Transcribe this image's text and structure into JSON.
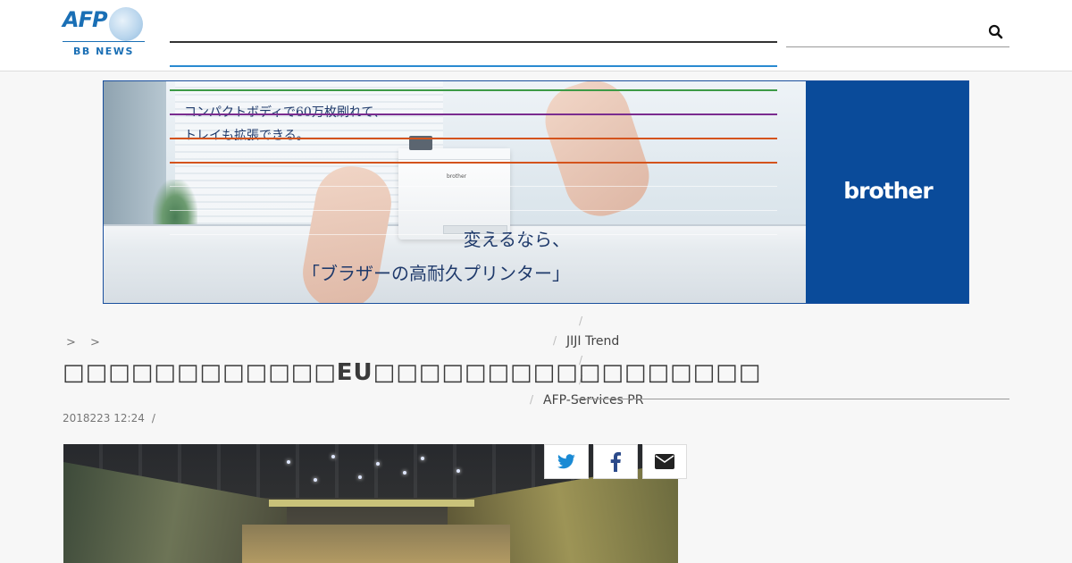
{
  "header": {
    "logo_text": "AFP",
    "logo_subtitle": "BB NEWS",
    "search_icon": "search-icon"
  },
  "ad": {
    "copy_lines": "コンパクトボディで60万枚刷れて、\nトレイも拡張できる。",
    "printer_brand": "brother",
    "headline": "変えるなら、\n「ブラザーの高耐久プリンター」",
    "brand": "brother",
    "brand_color": "#0a4b9a"
  },
  "nav": {
    "separators": [
      "/",
      "/",
      "/",
      "/",
      "/"
    ],
    "items": [
      "JIJI Trend",
      "AFP-Services PR"
    ]
  },
  "breadcrumb": "> >",
  "article": {
    "title": "□□□□□□□□□□□□EU□□□□□□□□□□□□□□□□□",
    "date": "2018223 12:24",
    "meta_sep": "/"
  },
  "share": {
    "icons": [
      "twitter-icon",
      "facebook-icon",
      "email-icon"
    ]
  },
  "colors": {
    "nav_lines": [
      "#333333",
      "#2a8ad1",
      "#3c9a46",
      "#7a2c8f",
      "#d4531c",
      "#d4531c"
    ]
  }
}
